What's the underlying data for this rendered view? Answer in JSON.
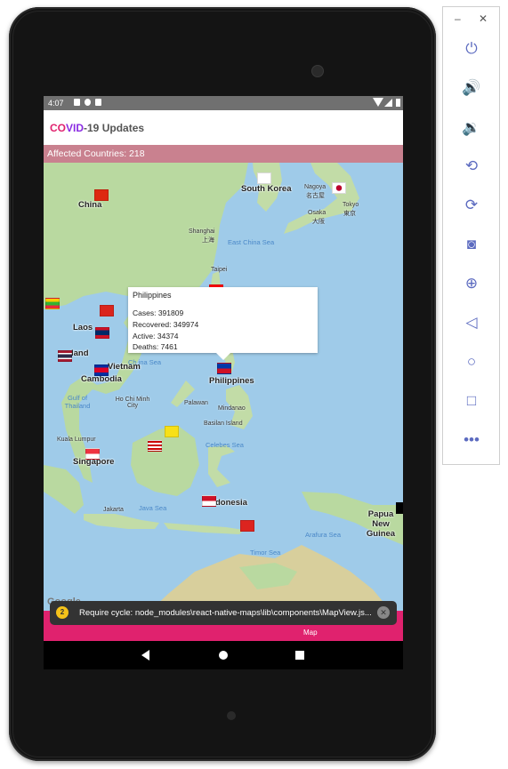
{
  "status_bar": {
    "time": "4:07"
  },
  "app": {
    "title_co": "CO",
    "title_vid": "VID",
    "title_rest": "-19 Updates"
  },
  "summary": {
    "affected_countries": "Affected Countries: 218"
  },
  "map": {
    "labels": [
      "China",
      "South Korea",
      "Laos",
      "Vietnam",
      "Cambodia",
      "Philippines",
      "Singapore",
      "donesia",
      "Papua New Guinea",
      "land"
    ],
    "sea_labels": [
      "East China Sea",
      "Gulf of Thailand",
      "Celebes Sea",
      "Java Sea",
      "Arafura Sea",
      "Timor Sea",
      "Ch ina Sea"
    ],
    "city_labels": [
      "Shanghai",
      "上海",
      "Taipei",
      "Nagoya",
      "名古屋",
      "Osaka",
      "大阪",
      "Tokyo",
      "東京",
      "Ho Chi Minh City",
      "Palawan",
      "Mindanao",
      "Basilan Island",
      "Kuala Lumpur",
      "Jakarta"
    ],
    "attribution": "Google"
  },
  "popup": {
    "country": "Philippines",
    "cases": "Cases: 391809",
    "recovered": "Recovered: 349974",
    "active": "Active: 34374",
    "deaths": "Deaths: 7461"
  },
  "toast": {
    "count": "2",
    "message": "Require cycle: node_modules\\react-native-maps\\lib\\components\\MapView.js..."
  },
  "bottom_nav": {
    "active_label": "Map"
  },
  "emulator_toolbar": {
    "buttons": [
      "power-icon",
      "volume-up-icon",
      "volume-down-icon",
      "rotate-left-icon",
      "rotate-right-icon",
      "camera-icon",
      "zoom-icon",
      "back-icon",
      "home-icon",
      "overview-icon",
      "more-icon"
    ]
  },
  "colors": {
    "accent": "#e0226e",
    "banner": "#c9818f",
    "sea": "#9fcbe9",
    "land": "#b8dba0"
  }
}
